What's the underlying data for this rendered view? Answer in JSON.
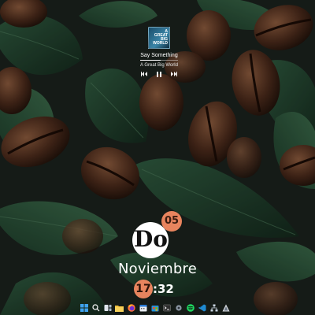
{
  "media": {
    "album_art_text": [
      "A",
      "GREAT",
      "BIG",
      "WORLD"
    ],
    "title": "Say Something",
    "artist": "A Great Big World",
    "progress": 0.55,
    "controls": [
      "previous-icon",
      "pause-icon",
      "next-icon"
    ]
  },
  "clock": {
    "day_name": "Do",
    "day_number": "05",
    "month": "Noviembre",
    "hour": "17",
    "separator": ":",
    "minute": "32"
  },
  "taskbar": {
    "icons": [
      "windows-start-icon",
      "search-icon",
      "task-view-icon",
      "file-explorer-icon",
      "firefox-icon",
      "calendar-icon",
      "store-icon",
      "terminal-icon",
      "settings-icon",
      "spotify-icon",
      "vscode-icon",
      "network-icon",
      "app-icon"
    ]
  },
  "colors": {
    "accent": "#e8845e",
    "text": "#ffffff",
    "leaf_dark": "#1e3d2a",
    "bean": "#5a3322"
  }
}
